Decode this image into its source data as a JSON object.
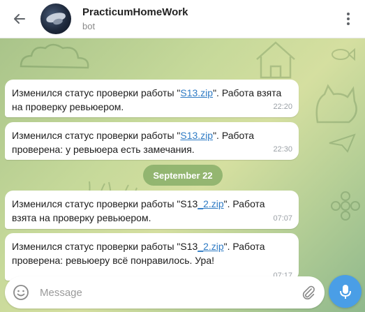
{
  "header": {
    "title": "PracticumHomeWork",
    "subtitle": "bot"
  },
  "messages": [
    {
      "text_before": "Изменился статус проверки работы \"",
      "link": "S13.zip",
      "text_after": "\". Работа взята на проверку ревьюером.",
      "time": "22:20"
    },
    {
      "text_before": "Изменился статус проверки работы \"",
      "link": "S13.zip",
      "text_after": "\". Работа проверена: у ревьюера есть замечания.",
      "time": "22:30"
    },
    {
      "text_before": "Изменился статус проверки работы \"S13",
      "link": "_2.zip",
      "text_after": "\". Работа взята на проверку ревьюером.",
      "time": "07:07"
    },
    {
      "text_before": "Изменился статус проверки работы \"S13",
      "link": "_2.zip",
      "text_after": "\". Работа проверена: ревьюеру всё понравилось. Ура!",
      "time": "07:17"
    }
  ],
  "date_separator": "September 22",
  "composer": {
    "placeholder": "Message"
  },
  "colors": {
    "accent": "#4a9ee6",
    "link": "#2f7bc4",
    "date_pill": "#82aa64"
  },
  "icons": {
    "back": "arrow-left-icon",
    "menu": "more-vertical-icon",
    "emoji": "smile-icon",
    "attach": "paperclip-icon",
    "mic": "microphone-icon"
  }
}
